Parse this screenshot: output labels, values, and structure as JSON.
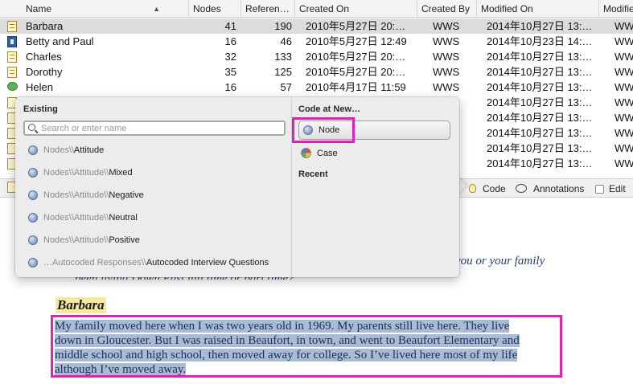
{
  "table": {
    "columns": [
      "Name",
      "Nodes",
      "Referen…",
      "Created On",
      "Created By",
      "Modified On",
      "Modifie"
    ],
    "rows": [
      {
        "name": "Barbara",
        "nodes": "41",
        "references": "190",
        "created_on": "2010年5月27日 20:…",
        "created_by": "WWS",
        "modified_on": "2014年10月27日 13:…",
        "modified_by": "WW",
        "icon": "document-icon"
      },
      {
        "name": "Betty and Paul",
        "nodes": "16",
        "references": "46",
        "created_on": "2010年5月27日 12:49",
        "created_by": "WWS",
        "modified_on": "2014年10月23日 14:…",
        "modified_by": "WW",
        "icon": "video-icon"
      },
      {
        "name": "Charles",
        "nodes": "32",
        "references": "133",
        "created_on": "2010年5月27日 20:…",
        "created_by": "WWS",
        "modified_on": "2014年10月27日 13:…",
        "modified_by": "WW",
        "icon": "document-icon"
      },
      {
        "name": "Dorothy",
        "nodes": "35",
        "references": "125",
        "created_on": "2010年5月27日 20:…",
        "created_by": "WWS",
        "modified_on": "2014年10月27日 13:…",
        "modified_by": "WW",
        "icon": "document-icon"
      },
      {
        "name": "Helen",
        "nodes": "16",
        "references": "57",
        "created_on": "2010年4月17日 11:59",
        "created_by": "WWS",
        "modified_on": "2014年10月27日 13:…",
        "modified_by": "WW",
        "icon": "memo-icon"
      }
    ],
    "hidden_rows": [
      {
        "modified_on": "2014年10月27日 13:…",
        "modified_by": "WW"
      },
      {
        "modified_on": "2014年10月27日 13:…",
        "modified_by": "WW"
      },
      {
        "modified_on": "2014年10月27日 13:…",
        "modified_by": "WW"
      },
      {
        "modified_on": "2014年10月27日 13:…",
        "modified_by": "WW"
      },
      {
        "modified_on": "2014年10月27日 13:…",
        "modified_by": "WW"
      }
    ]
  },
  "toolbar": {
    "code_label": "Code",
    "annotations_label": "Annotations",
    "edit_label": "Edit"
  },
  "popover": {
    "existing_title": "Existing",
    "search_placeholder": "Search or enter name",
    "nodes": [
      {
        "prefix": "Nodes\\\\",
        "leaf": "Attitude"
      },
      {
        "prefix": "Nodes\\\\Attitude\\\\",
        "leaf": "Mixed"
      },
      {
        "prefix": "Nodes\\\\Attitude\\\\",
        "leaf": "Negative"
      },
      {
        "prefix": "Nodes\\\\Attitude\\\\",
        "leaf": "Neutral"
      },
      {
        "prefix": "Nodes\\\\Attitude\\\\",
        "leaf": "Positive"
      },
      {
        "prefix": "…Autocoded Responses\\\\",
        "leaf": "Autocoded Interview Questions"
      }
    ],
    "code_at_new_title": "Code at New…",
    "node_button": "Node",
    "case_label": "Case",
    "recent_title": "Recent"
  },
  "document": {
    "question_tail": "you or your family",
    "question_line2": "been living Down East full time or part time?",
    "speaker": "Barbara",
    "answer_lines": [
      "My family moved here when I was two years old in 1969. My parents still live here. They live",
      "down in Gloucester. But I was raised in Beaufort, in town, and went to Beaufort Elementary and",
      "middle school and high school, then moved away for college. So I’ve lived here most of my life",
      "although I’ve moved away."
    ]
  },
  "colors": {
    "highlight_outline": "#e020b8",
    "selection_fill": "#a9bcd3",
    "speaker_highlight": "#f3eaa0"
  }
}
